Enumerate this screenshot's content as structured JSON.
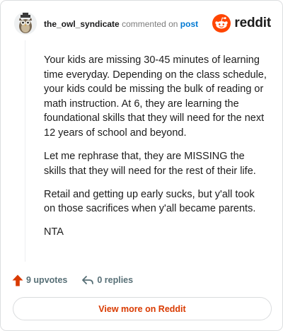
{
  "header": {
    "username": "the_owl_syndicate",
    "commented_label": "commented on",
    "post_label": "post",
    "brand": "reddit"
  },
  "comment": {
    "paragraphs": [
      "Your kids are missing 30-45 minutes of learning time everyday. Depending on the class schedule, your kids could be missing the bulk of reading or math instruction. At 6, they are learning the foundational skills that they will need for the next 12 years of school and beyond.",
      "Let me rephrase that, they are MISSING the skills that they will need for the rest of their life.",
      "Retail and getting up early sucks, but y'all took on those sacrifices when y'all became parents.",
      "NTA"
    ]
  },
  "actions": {
    "upvotes_label": "9 upvotes",
    "replies_label": "0 replies"
  },
  "footer": {
    "view_more_label": "View more on Reddit"
  },
  "colors": {
    "brand_orange": "#ff4500",
    "upvote_orange": "#d93a00",
    "link_blue": "#0079d3"
  },
  "icons": {
    "upvote": "upvote-arrow-icon",
    "reply": "reply-arrow-icon",
    "logo": "reddit-alien-logo"
  }
}
